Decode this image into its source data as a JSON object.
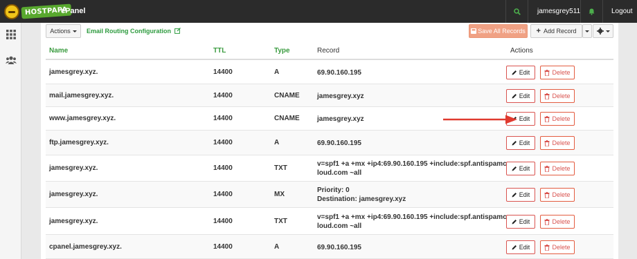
{
  "topbar": {
    "logo_text": "HOSTPAPA",
    "app_title": "cPanel",
    "username": "jamesgrey511",
    "logout_label": "Logout"
  },
  "toolbar": {
    "actions_label": "Actions",
    "email_routing_label": "Email Routing Configuration",
    "save_all_label": "Save All Records",
    "add_record_label": "Add Record"
  },
  "table": {
    "headers": {
      "name": "Name",
      "ttl": "TTL",
      "type": "Type",
      "record": "Record",
      "actions": "Actions"
    },
    "edit_label": "Edit",
    "delete_label": "Delete",
    "rows": [
      {
        "name": "jamesgrey.xyz.",
        "ttl": "14400",
        "type": "A",
        "record": [
          "69.90.160.195"
        ]
      },
      {
        "name": "mail.jamesgrey.xyz.",
        "ttl": "14400",
        "type": "CNAME",
        "record": [
          "jamesgrey.xyz"
        ]
      },
      {
        "name": "www.jamesgrey.xyz.",
        "ttl": "14400",
        "type": "CNAME",
        "record": [
          "jamesgrey.xyz"
        ]
      },
      {
        "name": "ftp.jamesgrey.xyz.",
        "ttl": "14400",
        "type": "A",
        "record": [
          "69.90.160.195"
        ]
      },
      {
        "name": "jamesgrey.xyz.",
        "ttl": "14400",
        "type": "TXT",
        "record": [
          "v=spf1 +a +mx +ip4:69.90.160.195 +include:spf.antispamc",
          "loud.com ~all"
        ]
      },
      {
        "name": "jamesgrey.xyz.",
        "ttl": "14400",
        "type": "MX",
        "record": [
          "Priority: 0",
          "Destination: jamesgrey.xyz"
        ]
      },
      {
        "name": "jamesgrey.xyz.",
        "ttl": "14400",
        "type": "TXT",
        "record": [
          "v=spf1 +a +mx +ip4:69.90.160.195 +include:spf.antispamc",
          "loud.com ~all"
        ]
      },
      {
        "name": "cpanel.jamesgrey.xyz.",
        "ttl": "14400",
        "type": "A",
        "record": [
          "69.90.160.195"
        ]
      }
    ]
  },
  "colors": {
    "accent_green": "#3a9b3f",
    "delete_red": "#d9534f",
    "save_all_bg": "#f0a184",
    "annotation_arrow": "#e03a2f"
  }
}
